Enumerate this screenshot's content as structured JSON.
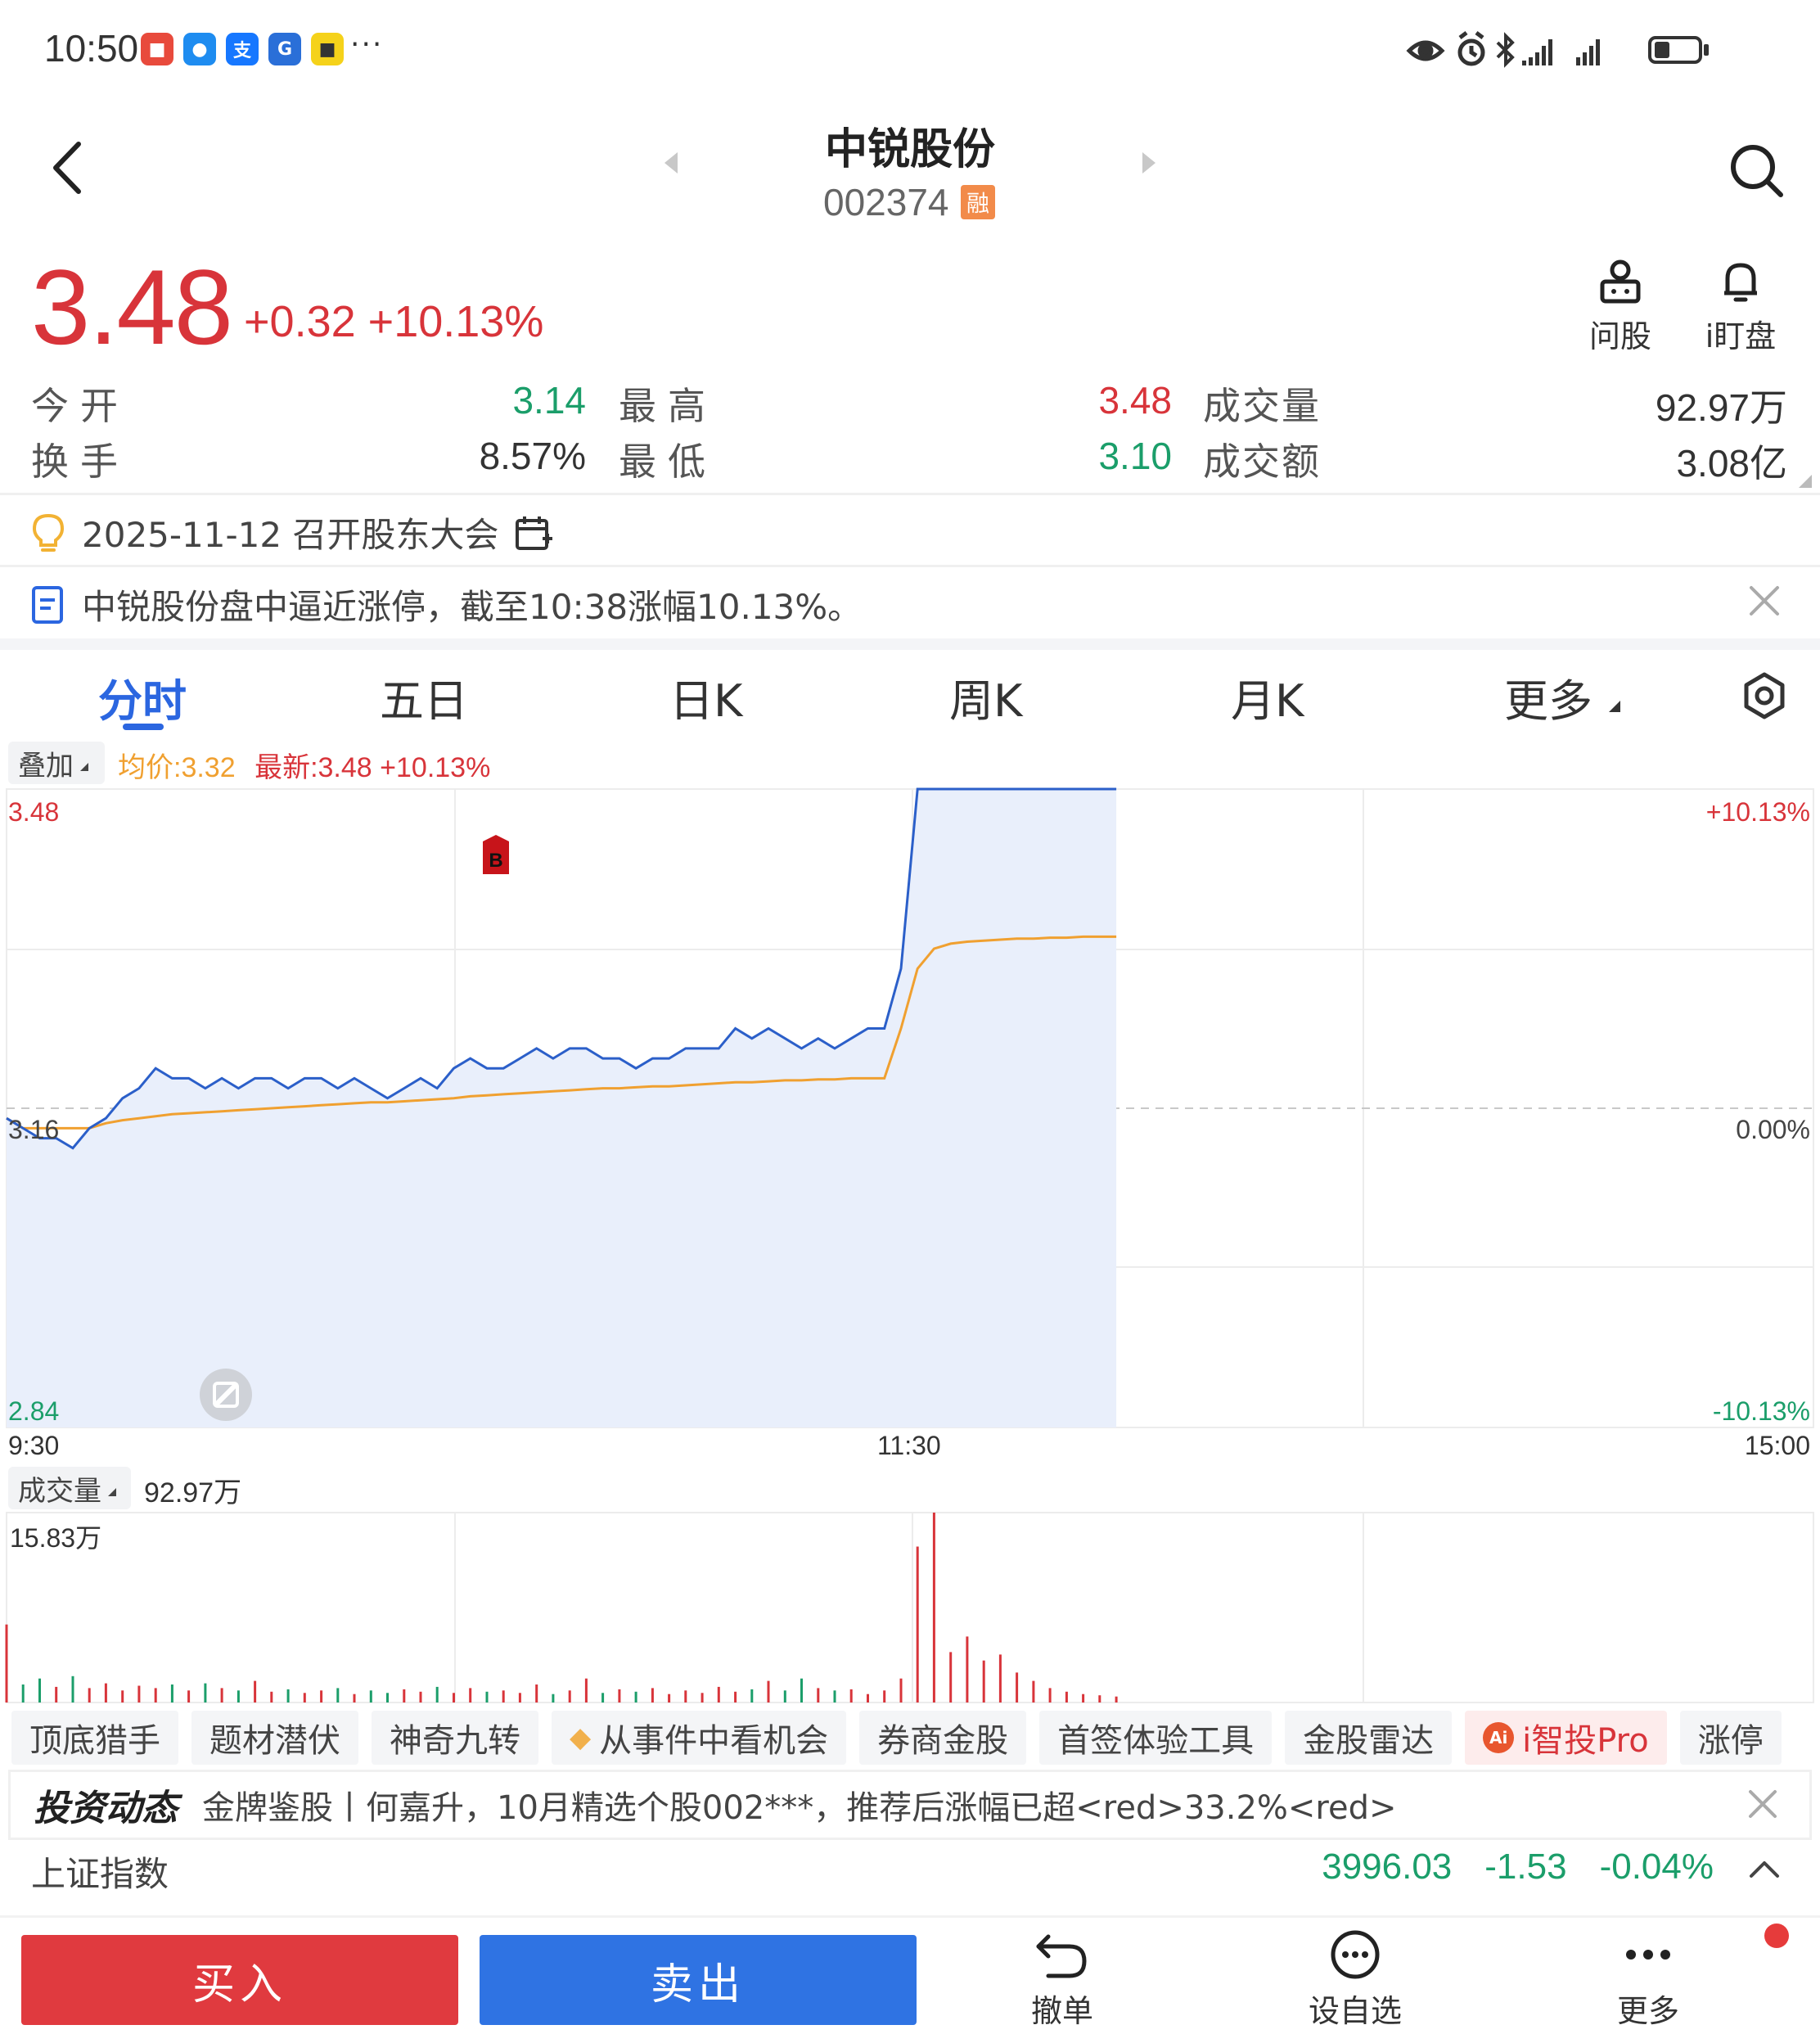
{
  "status_bar": {
    "time": "10:50",
    "more": "···",
    "icons": [
      "eye-icon",
      "alarm-icon",
      "bluetooth-icon",
      "signal-icon",
      "signal-icon",
      "battery-icon"
    ]
  },
  "header": {
    "title": "中锐股份",
    "code": "002374",
    "margin_badge": "融"
  },
  "quote": {
    "price": "3.48",
    "change": "+0.32",
    "change_pct": "+10.13%",
    "ask_label": "问股",
    "watch_label": "i盯盘"
  },
  "stats": {
    "open_label": "今开",
    "open_value": "3.14",
    "high_label": "最高",
    "high_value": "3.48",
    "volume_label": "成交量",
    "volume_value": "92.97万",
    "turnover_label": "换手",
    "turnover_value": "8.57%",
    "low_label": "最低",
    "low_value": "3.10",
    "amount_label": "成交额",
    "amount_value": "3.08亿"
  },
  "event": {
    "text": "2025-11-12 召开股东大会"
  },
  "news": {
    "text": "中锐股份盘中逼近涨停，截至10:38涨幅10.13%。"
  },
  "tabs": [
    "分时",
    "五日",
    "日K",
    "周K",
    "月K",
    "更多"
  ],
  "chart_controls": {
    "overlay_label": "叠加",
    "avg_label": "均价:3.32",
    "latest_label": "最新:3.48 +10.13%",
    "volume_label": "成交量",
    "volume_total": "92.97万"
  },
  "chart_data": {
    "type": "line",
    "y_left_labels": [
      "3.48",
      "3.16",
      "2.84"
    ],
    "y_right_labels": [
      "+10.13%",
      "0.00%",
      "-10.13%"
    ],
    "x_labels": [
      "9:30",
      "11:30",
      "15:00"
    ],
    "ylim": [
      2.84,
      3.48
    ],
    "prev_close": 3.16,
    "trade_marker": "B",
    "series": [
      {
        "name": "最新",
        "color": "#2b5fc9",
        "values": [
          3.15,
          3.14,
          3.13,
          3.13,
          3.12,
          3.14,
          3.15,
          3.17,
          3.18,
          3.2,
          3.19,
          3.19,
          3.18,
          3.19,
          3.18,
          3.19,
          3.19,
          3.18,
          3.19,
          3.19,
          3.18,
          3.19,
          3.18,
          3.17,
          3.18,
          3.19,
          3.18,
          3.2,
          3.21,
          3.2,
          3.2,
          3.21,
          3.22,
          3.21,
          3.22,
          3.22,
          3.21,
          3.21,
          3.2,
          3.21,
          3.21,
          3.22,
          3.22,
          3.22,
          3.24,
          3.23,
          3.24,
          3.23,
          3.22,
          3.23,
          3.22,
          3.23,
          3.24,
          3.24,
          3.3,
          3.48,
          3.48,
          3.48,
          3.48,
          3.48,
          3.48,
          3.48,
          3.48,
          3.48,
          3.48,
          3.48,
          3.48,
          3.48
        ]
      },
      {
        "name": "均价",
        "color": "#f0a030",
        "values": [
          3.15,
          3.14,
          3.14,
          3.14,
          3.14,
          3.14,
          3.145,
          3.148,
          3.15,
          3.152,
          3.154,
          3.155,
          3.156,
          3.157,
          3.158,
          3.159,
          3.16,
          3.161,
          3.162,
          3.163,
          3.164,
          3.165,
          3.166,
          3.166,
          3.167,
          3.168,
          3.169,
          3.17,
          3.172,
          3.173,
          3.174,
          3.175,
          3.176,
          3.177,
          3.178,
          3.179,
          3.18,
          3.18,
          3.181,
          3.182,
          3.182,
          3.183,
          3.184,
          3.185,
          3.186,
          3.186,
          3.187,
          3.188,
          3.188,
          3.189,
          3.189,
          3.19,
          3.19,
          3.19,
          3.24,
          3.3,
          3.32,
          3.325,
          3.327,
          3.328,
          3.329,
          3.33,
          3.33,
          3.331,
          3.331,
          3.332,
          3.332,
          3.332
        ]
      }
    ],
    "volume": {
      "max_label": "15.83万",
      "values": [
        6.5,
        1.5,
        2.0,
        1.3,
        2.2,
        1.2,
        1.6,
        1.0,
        1.4,
        1.2,
        1.5,
        1.0,
        1.6,
        1.2,
        1.0,
        1.8,
        0.9,
        1.1,
        0.8,
        1.0,
        1.2,
        0.7,
        1.0,
        0.8,
        1.1,
        0.9,
        1.3,
        0.8,
        1.2,
        0.9,
        1.0,
        0.8,
        1.5,
        0.7,
        1.0,
        2.0,
        0.8,
        1.1,
        0.9,
        1.2,
        0.7,
        1.0,
        0.8,
        1.3,
        0.9,
        1.1,
        1.8,
        1.0,
        2.0,
        1.2,
        1.0,
        1.1,
        0.7,
        1.0,
        2.0,
        13.0,
        15.83,
        4.2,
        5.5,
        3.5,
        4.0,
        2.5,
        1.8,
        1.2,
        0.9,
        0.7,
        0.6,
        0.5
      ]
    }
  },
  "tool_chips": [
    "顶底猎手",
    "题材潜伏",
    "神奇九转",
    "从事件中看机会",
    "券商金股",
    "首签体验工具",
    "金股雷达",
    "i智投Pro",
    "涨停"
  ],
  "invest": {
    "logo": "投资动态",
    "text": "金牌鉴股丨何嘉升，10月精选个股002***，推荐后涨幅已超<red>33.2%<red>"
  },
  "index": {
    "name": "上证指数",
    "value": "3996.03",
    "change": "-1.53",
    "change_pct": "-0.04%"
  },
  "bottom_bar": {
    "buy": "买入",
    "sell": "卖出",
    "cancel": "撤单",
    "watchlist": "设自选",
    "more": "更多"
  }
}
